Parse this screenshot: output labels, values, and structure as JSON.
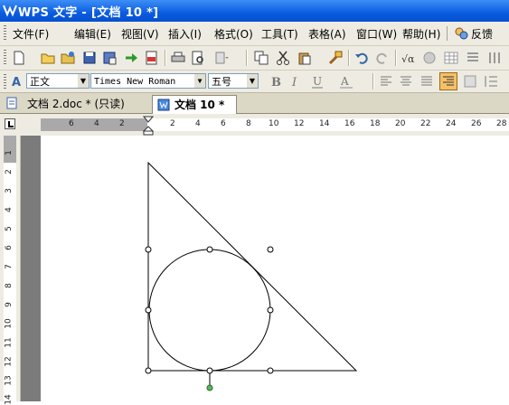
{
  "window": {
    "title": "WPS 文字 - [文档 10 *]"
  },
  "menu": {
    "items": [
      {
        "label": "文件(F)"
      },
      {
        "label": "编辑(E)"
      },
      {
        "label": "视图(V)"
      },
      {
        "label": "插入(I)"
      },
      {
        "label": "格式(O)"
      },
      {
        "label": "工具(T)"
      },
      {
        "label": "表格(A)"
      },
      {
        "label": "窗口(W)"
      },
      {
        "label": "帮助(H)"
      }
    ],
    "feedback": "反馈"
  },
  "format_bar": {
    "style": "正文",
    "font": "Times New Roman",
    "size": "五号"
  },
  "doc_tabs": [
    {
      "label": "文档 2.doc * (只读)"
    },
    {
      "label": "文档 10 *"
    }
  ],
  "ruler": {
    "h_labels": [
      "6",
      "4",
      "2",
      "2",
      "4",
      "6",
      "8",
      "10",
      "12",
      "14",
      "16",
      "18",
      "20",
      "22",
      "24",
      "26",
      "28"
    ],
    "v_labels": [
      "1",
      "2",
      "3",
      "4",
      "5",
      "6",
      "7",
      "8",
      "9",
      "10",
      "11",
      "12",
      "13",
      "14"
    ]
  },
  "icons": {
    "new": "new-document-icon",
    "open": "open-folder-icon",
    "save": "save-icon",
    "print": "print-icon",
    "cut": "cut-icon",
    "copy": "copy-icon",
    "paste": "paste-icon",
    "undo": "undo-icon",
    "redo": "redo-icon",
    "bold": "bold-icon",
    "italic": "italic-icon",
    "underline": "underline-icon",
    "align_right": "align-right-icon"
  },
  "colors": {
    "titlebar": "#0a5ce0",
    "toolbar_bg": "#eeece2",
    "active_align": "#f5c06a",
    "handle_rotate": "#5cb85c"
  }
}
